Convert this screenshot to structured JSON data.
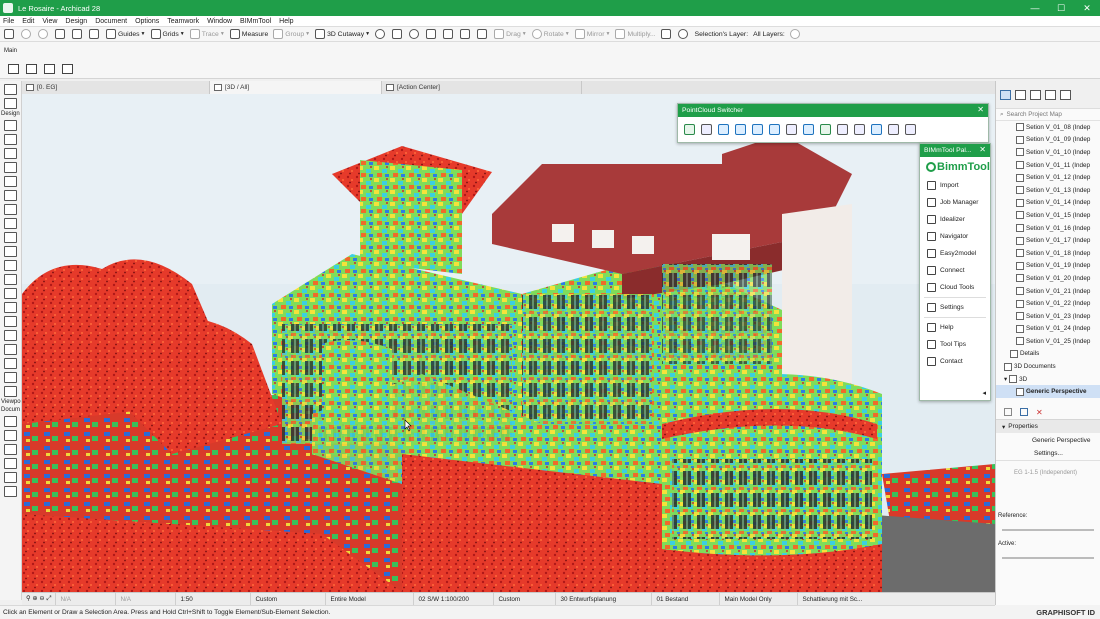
{
  "window": {
    "title": "Le Rosaire - Archicad 28",
    "controls": [
      "—",
      "☐",
      "✕"
    ]
  },
  "menu": [
    "File",
    "Edit",
    "View",
    "Design",
    "Document",
    "Options",
    "Teamwork",
    "Window",
    "BIMmTool",
    "Help"
  ],
  "toolbar": {
    "guides": "Guides",
    "grids": "Grids",
    "trace": "Trace",
    "measure": "Measure",
    "group": "Group",
    "cutaway": "3D Cutaway",
    "drag": "Drag",
    "rotate": "Rotate",
    "mirror": "Mirror",
    "multiply": "Multiply...",
    "selections_layer": "Selection's Layer:",
    "all_layers": "All Layers:"
  },
  "main_label": "Main",
  "tabs": [
    {
      "label": "[0. EG]"
    },
    {
      "label": "[3D / All]"
    },
    {
      "label": "[Action Center]"
    }
  ],
  "toolbox": {
    "design": "Design",
    "viewpoint": "Viewpo",
    "document": "Docum"
  },
  "pointcloud": {
    "title": "PointCloud Switcher",
    "close": "✕"
  },
  "bimmtool": {
    "title": "BIMmTool Pal...",
    "close": "✕",
    "logo_text": "BimmTool",
    "items": [
      "Import",
      "Job Manager",
      "Idealizer",
      "Navigator",
      "Easy2model",
      "Connect",
      "Cloud Tools",
      "Settings",
      "Help",
      "Tool Tips",
      "Contact"
    ],
    "collapse": "◂"
  },
  "project_map": {
    "search_placeholder": "Search Project Map",
    "items": [
      "Setion V_01_08 (Indep",
      "Setion V_01_09 (Indep",
      "Setion V_01_10 (Indep",
      "Setion V_01_11 (Indep",
      "Setion V_01_12 (Indep",
      "Setion V_01_13 (Indep",
      "Setion V_01_14 (Indep",
      "Setion V_01_15 (Indep",
      "Setion V_01_16 (Indep",
      "Setion V_01_17 (Indep",
      "Setion V_01_18 (Indep",
      "Setion V_01_19 (Indep",
      "Setion V_01_20 (Indep",
      "Setion V_01_21 (Indep",
      "Setion V_01_22 (Indep",
      "Setion V_01_23 (Indep",
      "Setion V_01_24 (Indep",
      "Setion V_01_25 (Indep"
    ],
    "details": "Details",
    "documents_3d": "3D Documents",
    "folder_3d": "3D",
    "generic_perspective": "Generic Perspective"
  },
  "properties": {
    "header": "Properties",
    "name": "Generic Perspective",
    "settings": "Settings...",
    "view_row": "EG 1-1.5 (Independent)",
    "reference": "Reference:",
    "active": "Active:"
  },
  "status": {
    "na1": "N/A",
    "na2": "N/A",
    "scale": "1:50",
    "custom1": "Custom",
    "model": "Entire Model",
    "drawing": "02 S/W 1:100/200",
    "custom2": "Custom",
    "plan": "30 Entwurfsplanung",
    "bestand": "01 Bestand",
    "main_model": "Main Model Only",
    "shading": "Schattierung mit Sc..."
  },
  "hint": "Click an Element or Draw a Selection Area. Press and Hold Ctrl+Shift to Toggle Element/Sub-Element Selection.",
  "brand": "GRAPHISOFT ID",
  "colors": {
    "accent": "#1f9e49",
    "selection": "#cfe0f5",
    "roof": "#a83a3a"
  }
}
